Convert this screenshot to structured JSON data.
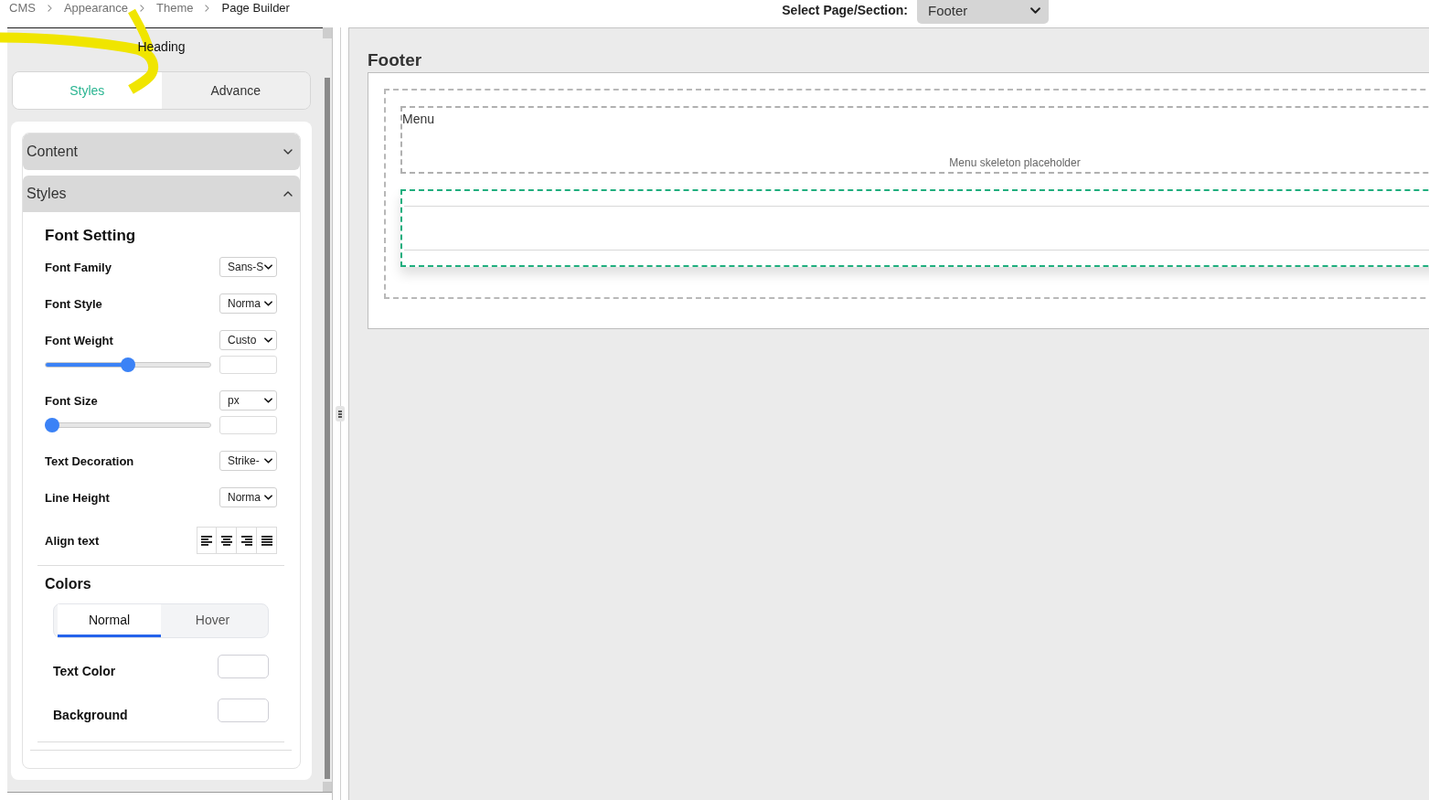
{
  "breadcrumb": [
    {
      "label": "CMS",
      "current": false
    },
    {
      "label": "Appearance",
      "current": false
    },
    {
      "label": "Theme",
      "current": false
    },
    {
      "label": "Page Builder",
      "current": true
    }
  ],
  "page_select": {
    "label": "Select Page/Section:",
    "value": "Footer"
  },
  "sidebar": {
    "title": "Heading",
    "tabs": [
      {
        "label": "Styles",
        "selected": true
      },
      {
        "label": "Advance",
        "selected": false
      }
    ],
    "sections": [
      {
        "title": "Content",
        "expanded": false
      },
      {
        "title": "Styles",
        "expanded": true,
        "font_setting": {
          "title": "Font Setting",
          "fields": [
            {
              "kind": "select",
              "label": "Font Family",
              "value": "Sans-S"
            },
            {
              "kind": "select",
              "label": "Font Style",
              "value": "Norma"
            },
            {
              "kind": "select_slider",
              "label": "Font Weight",
              "value": "Custo",
              "level": 0.5
            },
            {
              "kind": "select_slider",
              "label": "Font Size",
              "value": "px",
              "level": 0
            },
            {
              "kind": "select",
              "label": "Text Decoration",
              "value": "Strike-"
            },
            {
              "kind": "select",
              "label": "Line Height",
              "value": "Norma"
            },
            {
              "kind": "align",
              "label": "Align text"
            }
          ]
        },
        "colors": {
          "title": "Colors",
          "tabs": [
            {
              "label": "Normal",
              "selected": true
            },
            {
              "label": "Hover",
              "selected": false
            }
          ],
          "fields": [
            {
              "kind": "color",
              "label": "Text Color"
            },
            {
              "kind": "color",
              "label": "Background"
            }
          ]
        }
      }
    ]
  },
  "canvas": {
    "title": "Footer",
    "blocks": [
      {
        "kind": "menu",
        "label": "Menu",
        "note": "Menu skeleton placeholder",
        "selected": false
      },
      {
        "kind": "empty",
        "selected": true
      }
    ]
  }
}
